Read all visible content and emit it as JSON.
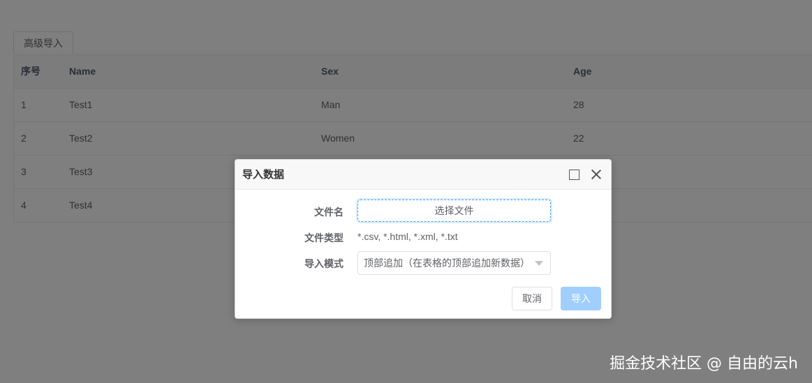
{
  "toolbar": {
    "advanced_import_label": "高级导入"
  },
  "table": {
    "columns": [
      "序号",
      "Name",
      "Sex",
      "Age"
    ],
    "rows": [
      [
        "1",
        "Test1",
        "Man",
        "28"
      ],
      [
        "2",
        "Test2",
        "Women",
        "22"
      ],
      [
        "3",
        "Test3",
        "",
        ""
      ],
      [
        "4",
        "Test4",
        "",
        ""
      ]
    ]
  },
  "dialog": {
    "title": "导入数据",
    "file_label": "文件名",
    "file_button": "选择文件",
    "type_label": "文件类型",
    "type_value": "*.csv, *.html, *.xml, *.txt",
    "mode_label": "导入模式",
    "mode_value": "顶部追加（在表格的顶部追加新数据）",
    "cancel_label": "取消",
    "import_label": "导入"
  },
  "watermark": "掘金技术社区 @ 自由的云h"
}
